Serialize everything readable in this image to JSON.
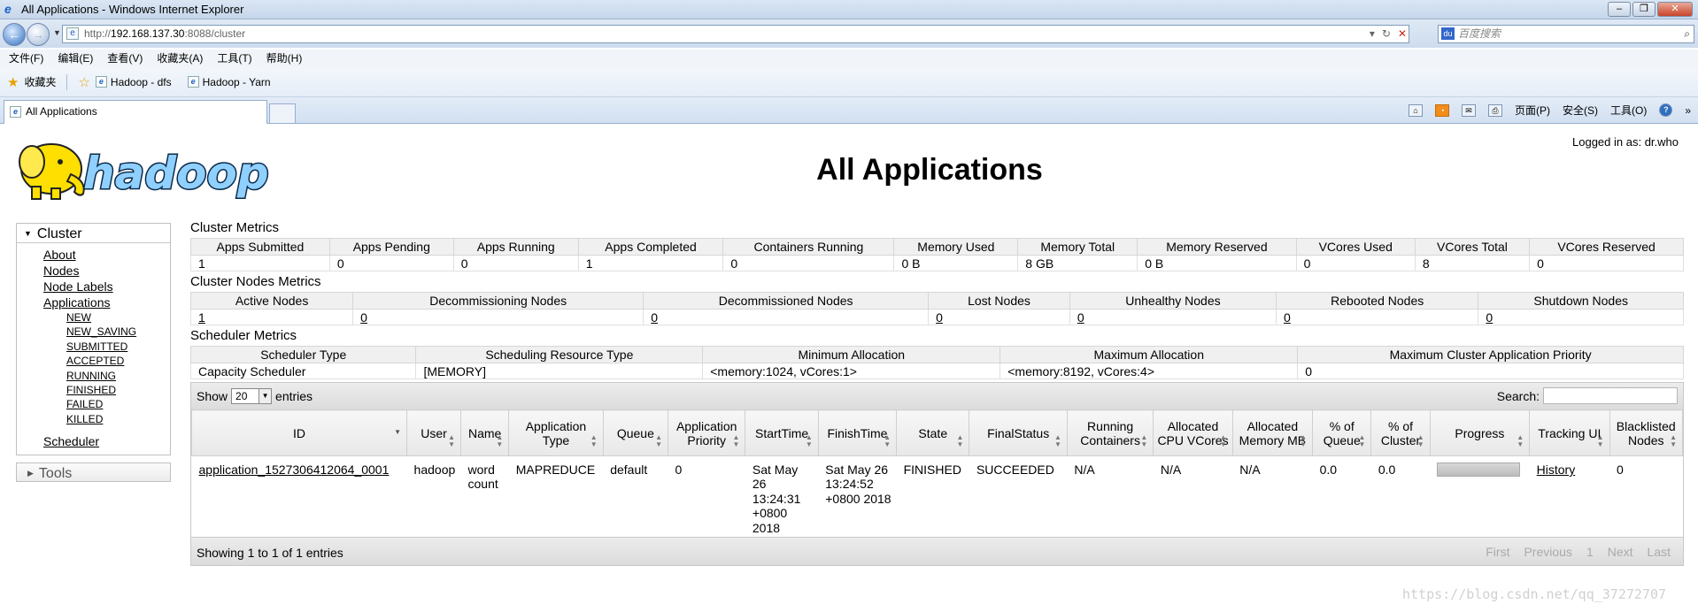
{
  "window": {
    "title": "All Applications - Windows Internet Explorer",
    "address_prefix": "http://",
    "address_host": "192.168.137.30",
    "address_rest": ":8088/cluster",
    "search_placeholder": "百度搜索"
  },
  "menu": [
    "文件(F)",
    "编辑(E)",
    "查看(V)",
    "收藏夹(A)",
    "工具(T)",
    "帮助(H)"
  ],
  "favorites": {
    "label": "收藏夹",
    "links": [
      "Hadoop - dfs",
      "Hadoop - Yarn"
    ]
  },
  "tab": {
    "label": "All Applications"
  },
  "commandbar": {
    "page": "页面(P)",
    "safety": "安全(S)",
    "tools": "工具(O)"
  },
  "page": {
    "logo_text": "hadoop",
    "title": "All Applications",
    "login": "Logged in as: dr.who"
  },
  "sidebar": {
    "cluster_label": "Cluster",
    "links": [
      "About",
      "Nodes",
      "Node Labels",
      "Applications"
    ],
    "app_states": [
      "NEW",
      "NEW_SAVING",
      "SUBMITTED",
      "ACCEPTED",
      "RUNNING",
      "FINISHED",
      "FAILED",
      "KILLED"
    ],
    "scheduler": "Scheduler",
    "tools_label": "Tools"
  },
  "cluster_metrics": {
    "title": "Cluster Metrics",
    "headers": [
      "Apps Submitted",
      "Apps Pending",
      "Apps Running",
      "Apps Completed",
      "Containers Running",
      "Memory Used",
      "Memory Total",
      "Memory Reserved",
      "VCores Used",
      "VCores Total",
      "VCores Reserved"
    ],
    "values": [
      "1",
      "0",
      "0",
      "1",
      "0",
      "0 B",
      "8 GB",
      "0 B",
      "0",
      "8",
      "0"
    ]
  },
  "nodes_metrics": {
    "title": "Cluster Nodes Metrics",
    "headers": [
      "Active Nodes",
      "Decommissioning Nodes",
      "Decommissioned Nodes",
      "Lost Nodes",
      "Unhealthy Nodes",
      "Rebooted Nodes",
      "Shutdown Nodes"
    ],
    "values": [
      "1",
      "0",
      "0",
      "0",
      "0",
      "0",
      "0"
    ]
  },
  "scheduler_metrics": {
    "title": "Scheduler Metrics",
    "headers": [
      "Scheduler Type",
      "Scheduling Resource Type",
      "Minimum Allocation",
      "Maximum Allocation",
      "Maximum Cluster Application Priority"
    ],
    "values": [
      "Capacity Scheduler",
      "[MEMORY]",
      "<memory:1024, vCores:1>",
      "<memory:8192, vCores:4>",
      "0"
    ]
  },
  "apps_table": {
    "show_label": "Show",
    "show_value": "20",
    "entries_label": "entries",
    "search_label": "Search:",
    "headers": [
      "ID",
      "User",
      "Name",
      "Application Type",
      "Queue",
      "Application Priority",
      "StartTime",
      "FinishTime",
      "State",
      "FinalStatus",
      "Running Containers",
      "Allocated CPU VCores",
      "Allocated Memory MB",
      "% of Queue",
      "% of Cluster",
      "Progress",
      "Tracking UI",
      "Blacklisted Nodes"
    ],
    "row": {
      "id": "application_1527306412064_0001",
      "user": "hadoop",
      "name": "word count",
      "type": "MAPREDUCE",
      "queue": "default",
      "priority": "0",
      "start": "Sat May 26 13:24:31 +0800 2018",
      "finish": "Sat May 26 13:24:52 +0800 2018",
      "state": "FINISHED",
      "final_status": "SUCCEEDED",
      "running_containers": "N/A",
      "alloc_vcores": "N/A",
      "alloc_mem": "N/A",
      "pct_queue": "0.0",
      "pct_cluster": "0.0",
      "progress": 1.0,
      "tracking": "History",
      "blacklisted": "0"
    },
    "info": "Showing 1 to 1 of 1 entries",
    "pager": [
      "First",
      "Previous",
      "1",
      "Next",
      "Last"
    ]
  },
  "watermark": "https://blog.csdn.net/qq_37272707"
}
